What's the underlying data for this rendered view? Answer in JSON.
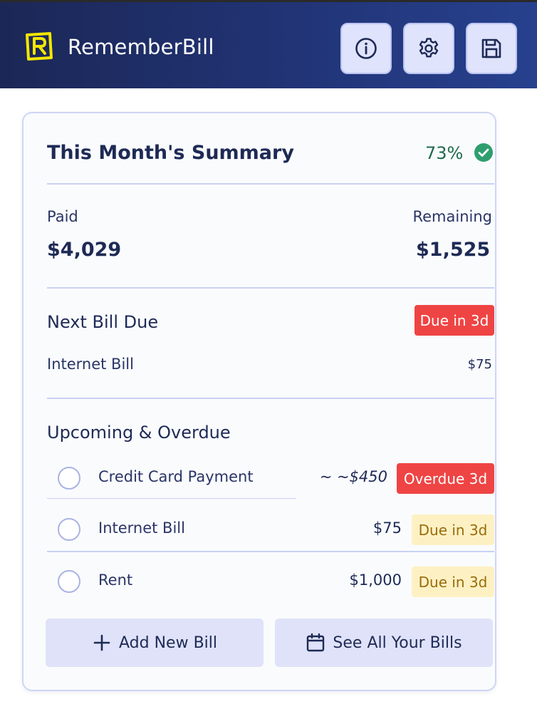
{
  "header": {
    "app_name": "RememberBill",
    "info_button": "info-icon",
    "settings_button": "gear-icon",
    "save_button": "save-icon"
  },
  "summary": {
    "title": "This Month's Summary",
    "percent_paid": "73%",
    "paid_label": "Paid",
    "paid_value": "$4,029",
    "remaining_label": "Remaining",
    "remaining_value": "$1,525"
  },
  "next_bill": {
    "title": "Next Bill Due",
    "badge": "Due in 3d",
    "name": "Internet Bill",
    "amount": "$75"
  },
  "upcoming": {
    "title": "Upcoming & Overdue",
    "items": [
      {
        "name": "Credit Card Payment",
        "amount": "~ ~$450",
        "badge": "Overdue 3d",
        "status": "overdue"
      },
      {
        "name": "Internet Bill",
        "amount": "$75",
        "badge": "Due in 3d",
        "status": "due"
      },
      {
        "name": "Rent",
        "amount": "$1,000",
        "badge": "Due in 3d",
        "status": "due"
      }
    ]
  },
  "actions": {
    "add_label": "Add New Bill",
    "see_all_label": "See All Your Bills"
  },
  "colors": {
    "header_gradient_start": "#1b2756",
    "header_gradient_end": "#27418e",
    "overdue_red": "#ef4444",
    "due_yellow_bg": "#fdf1c4",
    "success_green": "#2f9e6e",
    "button_bg": "#dfe2f8"
  }
}
